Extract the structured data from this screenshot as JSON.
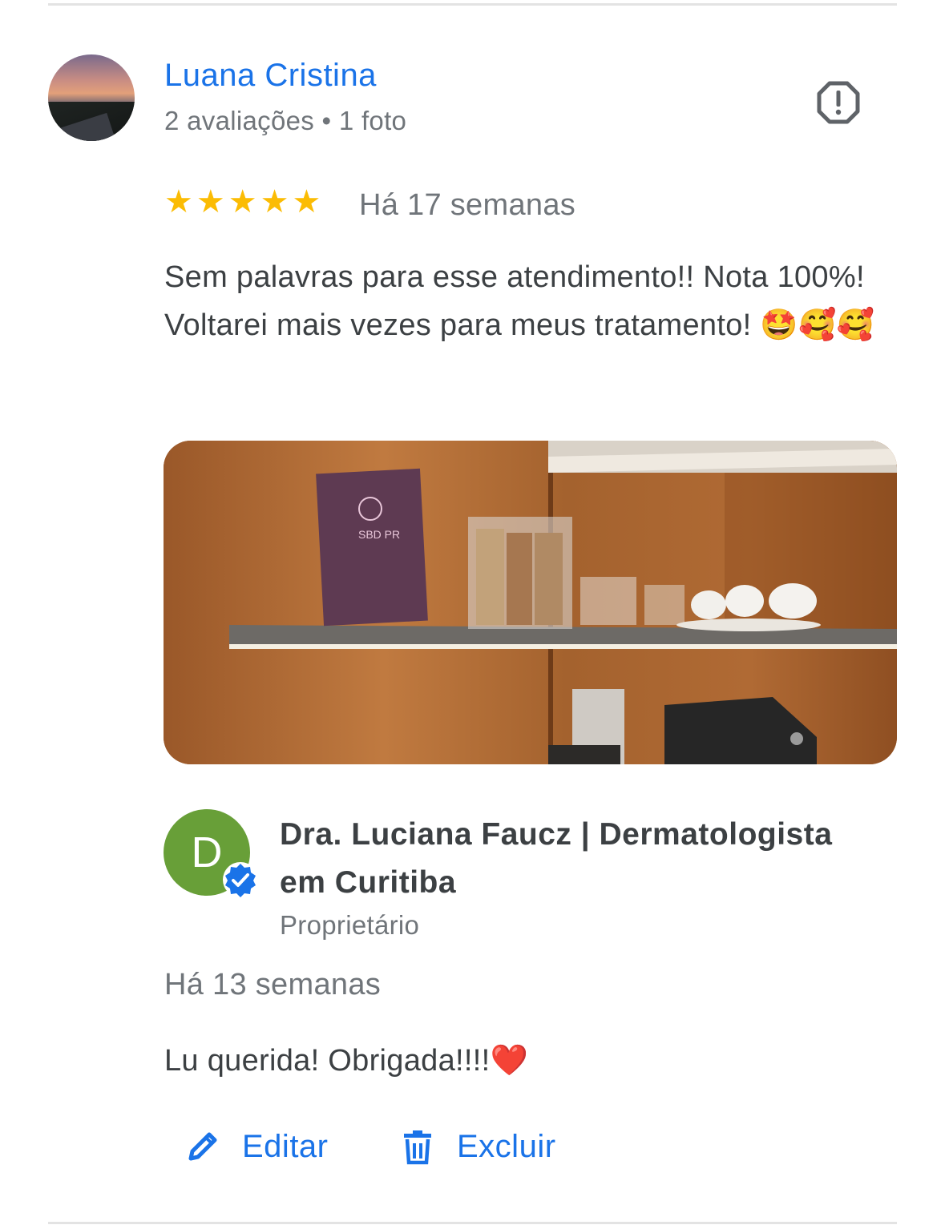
{
  "review": {
    "reviewer_name": "Luana Cristina",
    "reviewer_meta": "2 avaliações • 1 foto",
    "rating": 5,
    "date": "Há 17 semanas",
    "text": "Sem palavras para esse atendimento!! Nota 100%! Voltarei mais vezes para meus tratamento! 🤩🥰🥰",
    "photo_sign_text": "SBD PR"
  },
  "owner_reply": {
    "avatar_letter": "D",
    "name": "Dra. Luciana Faucz | Dermatologista em Curitiba",
    "role": "Proprietário",
    "date": "Há 13 semanas",
    "text": "Lu querida! Obrigada!!!!",
    "emoji": "❤️"
  },
  "actions": {
    "edit_label": "Editar",
    "delete_label": "Excluir"
  },
  "colors": {
    "link_blue": "#1a73e8",
    "star_yellow": "#fbbc04",
    "owner_avatar_green": "#689f38"
  }
}
